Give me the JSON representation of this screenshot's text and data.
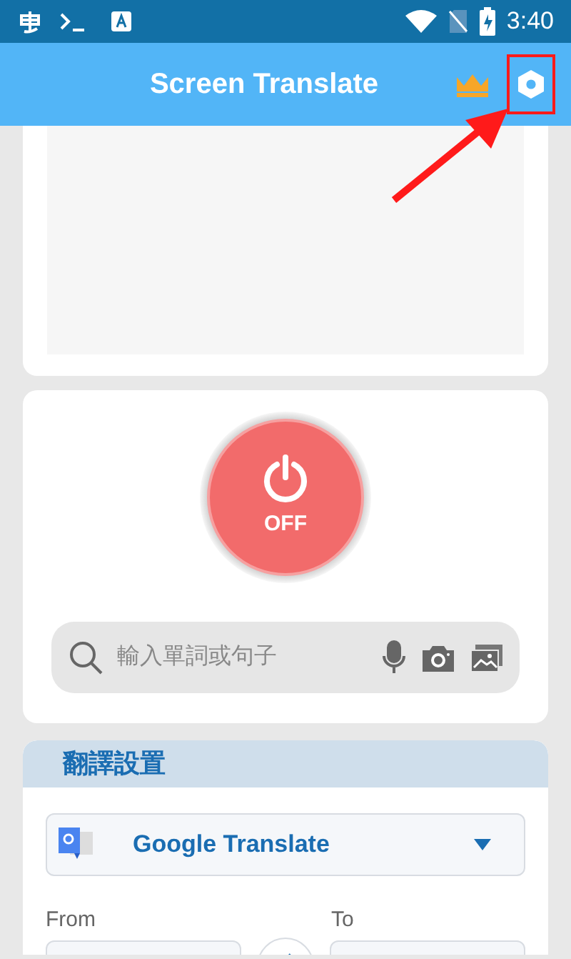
{
  "status_bar": {
    "time": "3:40"
  },
  "app_bar": {
    "title": "Screen Translate"
  },
  "power_button": {
    "on": false,
    "label": "OFF"
  },
  "search": {
    "placeholder": "輸入單詞或句子"
  },
  "settings_card": {
    "title": "翻譯設置",
    "engine": "Google Translate",
    "from_label": "From",
    "to_label": "To"
  }
}
